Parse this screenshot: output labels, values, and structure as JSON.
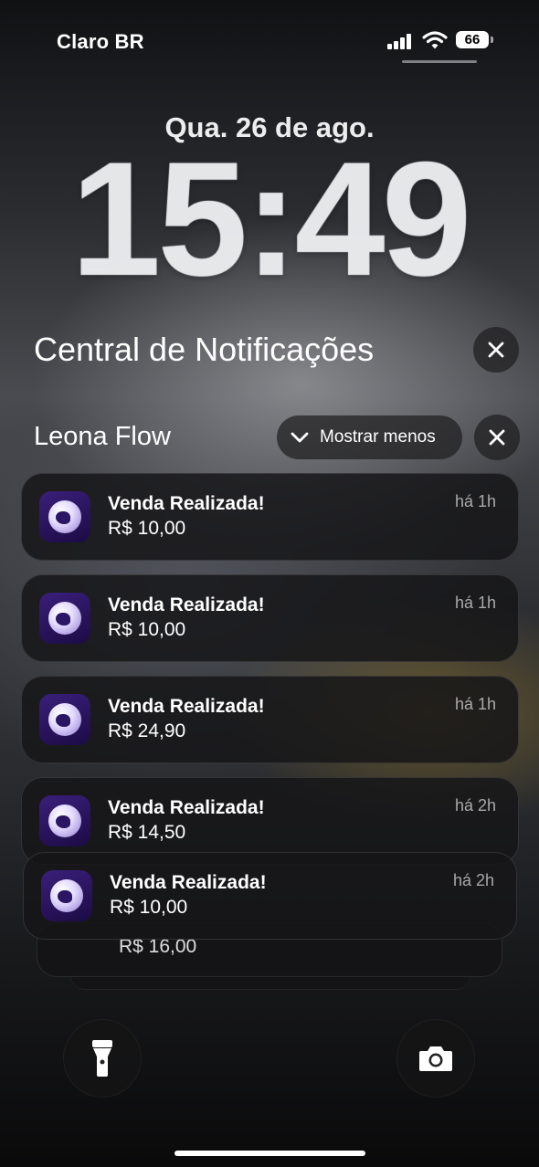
{
  "status_bar": {
    "carrier": "Claro BR",
    "battery": "66"
  },
  "lockscreen": {
    "date": "Qua. 26 de ago.",
    "time": "15:49"
  },
  "notification_center": {
    "title": "Central de Notificações",
    "group": {
      "app_name": "Leona Flow",
      "show_less_label": "Mostrar menos",
      "notifications": [
        {
          "title": "Venda Realizada!",
          "amount": "R$ 10,00",
          "time": "há 1h"
        },
        {
          "title": "Venda Realizada!",
          "amount": "R$ 10,00",
          "time": "há 1h"
        },
        {
          "title": "Venda Realizada!",
          "amount": "R$ 24,90",
          "time": "há 1h"
        },
        {
          "title": "Venda Realizada!",
          "amount": "R$ 14,50",
          "time": "há 2h"
        },
        {
          "title": "Venda Realizada!",
          "amount": "R$ 10,00",
          "time": "há 2h"
        }
      ],
      "stacked_peek_amount": "R$ 16,00"
    }
  },
  "bottom_controls": {
    "left": "flashlight-icon",
    "right": "camera-icon"
  }
}
